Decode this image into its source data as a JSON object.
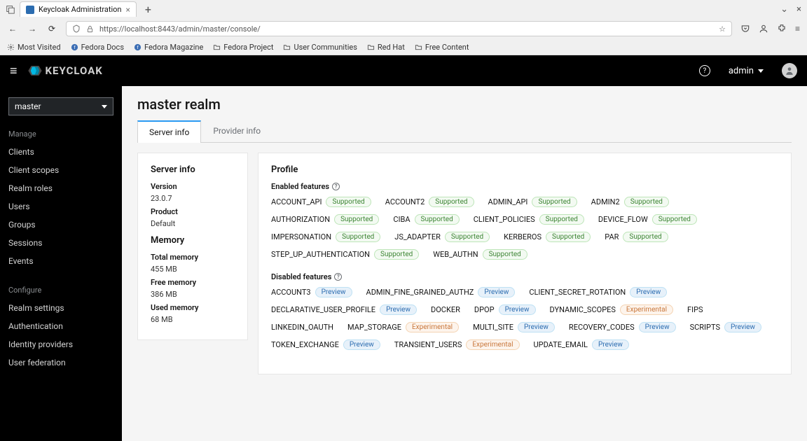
{
  "browser": {
    "tab_title": "Keycloak Administration",
    "url_display": "https://localhost:8443/admin/master/console/",
    "bookmarks": [
      {
        "label": "Most Visited",
        "icon": "gear"
      },
      {
        "label": "Fedora Docs",
        "icon": "fedora"
      },
      {
        "label": "Fedora Magazine",
        "icon": "fedora"
      },
      {
        "label": "Fedora Project",
        "icon": "folder"
      },
      {
        "label": "User Communities",
        "icon": "folder"
      },
      {
        "label": "Red Hat",
        "icon": "folder"
      },
      {
        "label": "Free Content",
        "icon": "folder"
      }
    ]
  },
  "header": {
    "brand": "KEYCLOAK",
    "user": "admin"
  },
  "sidebar": {
    "realm": "master",
    "manage_heading": "Manage",
    "manage_items": [
      "Clients",
      "Client scopes",
      "Realm roles",
      "Users",
      "Groups",
      "Sessions",
      "Events"
    ],
    "configure_heading": "Configure",
    "configure_items": [
      "Realm settings",
      "Authentication",
      "Identity providers",
      "User federation"
    ]
  },
  "page": {
    "title": "master realm",
    "tabs": [
      "Server info",
      "Provider info"
    ],
    "active_tab": "Server info"
  },
  "server_info": {
    "heading": "Server info",
    "version_label": "Version",
    "version": "23.0.7",
    "product_label": "Product",
    "product": "Default",
    "memory_heading": "Memory",
    "total_label": "Total memory",
    "total": "455 MB",
    "free_label": "Free memory",
    "free": "386 MB",
    "used_label": "Used memory",
    "used": "68 MB"
  },
  "profile": {
    "heading": "Profile",
    "enabled_heading": "Enabled features",
    "disabled_heading": "Disabled features",
    "badge_labels": {
      "supported": "Supported",
      "preview": "Preview",
      "experimental": "Experimental"
    },
    "enabled": [
      {
        "name": "ACCOUNT_API",
        "badge": "supported"
      },
      {
        "name": "ACCOUNT2",
        "badge": "supported"
      },
      {
        "name": "ADMIN_API",
        "badge": "supported"
      },
      {
        "name": "ADMIN2",
        "badge": "supported"
      },
      {
        "name": "AUTHORIZATION",
        "badge": "supported"
      },
      {
        "name": "CIBA",
        "badge": "supported"
      },
      {
        "name": "CLIENT_POLICIES",
        "badge": "supported"
      },
      {
        "name": "DEVICE_FLOW",
        "badge": "supported"
      },
      {
        "name": "IMPERSONATION",
        "badge": "supported"
      },
      {
        "name": "JS_ADAPTER",
        "badge": "supported"
      },
      {
        "name": "KERBEROS",
        "badge": "supported"
      },
      {
        "name": "PAR",
        "badge": "supported"
      },
      {
        "name": "STEP_UP_AUTHENTICATION",
        "badge": "supported"
      },
      {
        "name": "WEB_AUTHN",
        "badge": "supported"
      }
    ],
    "disabled": [
      {
        "name": "ACCOUNT3",
        "badge": "preview"
      },
      {
        "name": "ADMIN_FINE_GRAINED_AUTHZ",
        "badge": "preview"
      },
      {
        "name": "CLIENT_SECRET_ROTATION",
        "badge": "preview"
      },
      {
        "name": "DECLARATIVE_USER_PROFILE",
        "badge": "preview"
      },
      {
        "name": "DOCKER",
        "badge": null
      },
      {
        "name": "DPOP",
        "badge": "preview"
      },
      {
        "name": "DYNAMIC_SCOPES",
        "badge": "experimental"
      },
      {
        "name": "FIPS",
        "badge": null
      },
      {
        "name": "LINKEDIN_OAUTH",
        "badge": null
      },
      {
        "name": "MAP_STORAGE",
        "badge": "experimental"
      },
      {
        "name": "MULTI_SITE",
        "badge": "preview"
      },
      {
        "name": "RECOVERY_CODES",
        "badge": "preview"
      },
      {
        "name": "SCRIPTS",
        "badge": "preview"
      },
      {
        "name": "TOKEN_EXCHANGE",
        "badge": "preview"
      },
      {
        "name": "TRANSIENT_USERS",
        "badge": "experimental"
      },
      {
        "name": "UPDATE_EMAIL",
        "badge": "preview"
      }
    ]
  }
}
